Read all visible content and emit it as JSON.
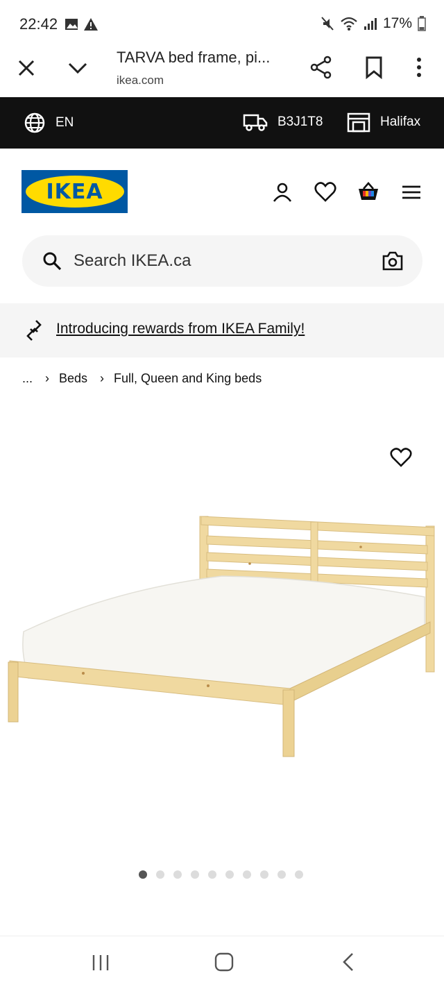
{
  "status_bar": {
    "time": "22:42",
    "battery": "17%",
    "icons": [
      "gallery-icon",
      "warning-icon",
      "mute-icon",
      "wifi-icon",
      "signal-icon",
      "battery-icon"
    ]
  },
  "browser": {
    "title": "TARVA bed frame, pi...",
    "url": "ikea.com"
  },
  "locale_bar": {
    "language": "EN",
    "postal_code": "B3J1T8",
    "store": "Halifax"
  },
  "header": {
    "logo_text": "IKEA"
  },
  "search": {
    "placeholder": "Search IKEA.ca"
  },
  "promo": {
    "link_text": "Introducing rewards from IKEA Family!"
  },
  "breadcrumb": {
    "items": [
      "...",
      "Beds",
      "Full, Queen and King beds"
    ]
  },
  "carousel": {
    "total": 10,
    "active": 1
  },
  "colors": {
    "ikea_blue": "#0058a3",
    "ikea_yellow": "#ffdb00",
    "locale_bar_bg": "#111111",
    "pine": "#f0d9a0",
    "mattress": "#f7f6f2"
  }
}
